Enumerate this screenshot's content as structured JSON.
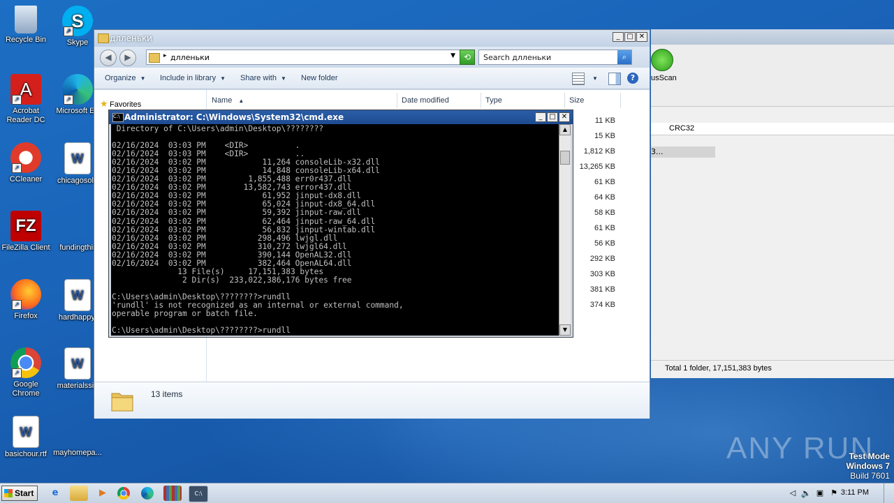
{
  "desktop_icons": [
    {
      "label": "Recycle Bin",
      "icon": "recycle-bin-icon"
    },
    {
      "label": "Skype",
      "icon": "skype-icon"
    },
    {
      "label": "Acrobat Reader DC",
      "icon": "acrobat-icon"
    },
    {
      "label": "Microsoft Ed",
      "icon": "edge-icon"
    },
    {
      "label": "CCleaner",
      "icon": "ccleaner-icon"
    },
    {
      "label": "chicagosolu",
      "icon": "word-doc-icon"
    },
    {
      "label": "FileZilla Client",
      "icon": "filezilla-icon"
    },
    {
      "label": "fundingthir",
      "icon": "blank-doc-icon"
    },
    {
      "label": "Firefox",
      "icon": "firefox-icon"
    },
    {
      "label": "hardhappy.",
      "icon": "word-doc-icon"
    },
    {
      "label": "Google Chrome",
      "icon": "chrome-icon"
    },
    {
      "label": "materialssin",
      "icon": "word-doc-icon"
    },
    {
      "label": "basichour.rtf",
      "icon": "word-doc-icon"
    },
    {
      "label": "mayhomepa...",
      "icon": "blank-doc-icon"
    }
  ],
  "background_app": {
    "toolbar_label": "usScan",
    "column_crc": "CRC32",
    "selected_row_text": "3...",
    "status": "Total 1 folder, 17,151,383 bytes"
  },
  "explorer": {
    "title": "длленьки",
    "address": "длленьки",
    "search_placeholder": "Search длленьки",
    "commands": {
      "organize": "Organize",
      "include_in_library": "Include in library",
      "share_with": "Share with",
      "new_folder": "New folder"
    },
    "favorites_label": "Favorites",
    "columns": {
      "name": "Name",
      "date_modified": "Date modified",
      "type": "Type",
      "size": "Size"
    },
    "sizes": [
      "11 KB",
      "15 KB",
      "1,812 KB",
      "13,265 KB",
      "61 KB",
      "64 KB",
      "58 KB",
      "61 KB",
      "56 KB",
      "292 KB",
      "303 KB",
      "381 KB",
      "374 KB"
    ],
    "item_count": "13 items"
  },
  "cmd": {
    "title": "Administrator: C:\\Windows\\System32\\cmd.exe",
    "console_text": " Directory of C:\\Users\\admin\\Desktop\\????????\n\n02/16/2024  03:03 PM    <DIR>          .\n02/16/2024  03:03 PM    <DIR>          ..\n02/16/2024  03:02 PM            11,264 consoleLib-x32.dll\n02/16/2024  03:02 PM            14,848 consoleLib-x64.dll\n02/16/2024  03:02 PM         1,855,488 err0r437.dll\n02/16/2024  03:02 PM        13,582,743 error437.dll\n02/16/2024  03:02 PM            61,952 jinput-dx8.dll\n02/16/2024  03:02 PM            65,024 jinput-dx8_64.dll\n02/16/2024  03:02 PM            59,392 jinput-raw.dll\n02/16/2024  03:02 PM            62,464 jinput-raw_64.dll\n02/16/2024  03:02 PM            56,832 jinput-wintab.dll\n02/16/2024  03:02 PM           298,496 lwjgl.dll\n02/16/2024  03:02 PM           310,272 lwjgl64.dll\n02/16/2024  03:02 PM           390,144 OpenAL32.dll\n02/16/2024  03:02 PM           382,464 OpenAL64.dll\n              13 File(s)     17,151,383 bytes\n               2 Dir(s)  233,022,386,176 bytes free\n\nC:\\Users\\admin\\Desktop\\????????>rundll\n'rundll' is not recognized as an internal or external command,\noperable program or batch file.\n\nC:\\Users\\admin\\Desktop\\????????>rundll"
  },
  "watermark": {
    "brand": "ANY RUN",
    "test_mode": "Test Mode",
    "os": "Windows 7",
    "build": "Build 7601"
  },
  "taskbar": {
    "start_label": "Start",
    "clock": "3:11 PM"
  }
}
